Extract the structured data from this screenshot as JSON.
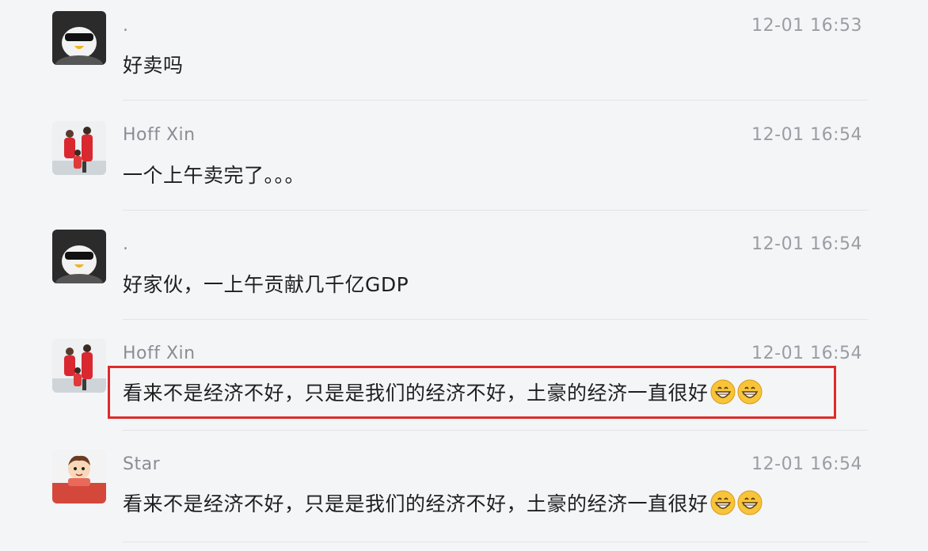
{
  "messages": [
    {
      "sender": ".",
      "time": "12-01 16:53",
      "text": "好卖吗",
      "avatar_icon": "penguin-sunglasses-icon"
    },
    {
      "sender": "Hoff Xin",
      "time": "12-01 16:54",
      "text": "一个上午卖完了。。。",
      "avatar_icon": "family-photo-icon"
    },
    {
      "sender": ".",
      "time": "12-01 16:54",
      "text": "好家伙，一上午贡献几千亿GDP",
      "avatar_icon": "penguin-sunglasses-icon"
    },
    {
      "sender": "Hoff Xin",
      "time": "12-01 16:54",
      "text": "看来不是经济不好，只是是我们的经济不好，土豪的经济一直很好",
      "emojis": [
        "grinning-face-icon",
        "grinning-face-icon"
      ],
      "highlighted": true,
      "avatar_icon": "family-photo-icon"
    },
    {
      "sender": "Star",
      "time": "12-01 16:54",
      "text": "看来不是经济不好，只是是我们的经济不好，土豪的经济一直很好",
      "emojis": [
        "grinning-face-icon",
        "grinning-face-icon"
      ],
      "avatar_icon": "cartoon-boy-icon"
    }
  ],
  "colors": {
    "background": "#f4f5f7",
    "sender_text": "#8a8d93",
    "message_text": "#1f1f1f",
    "highlight_border": "#e02a2a"
  }
}
